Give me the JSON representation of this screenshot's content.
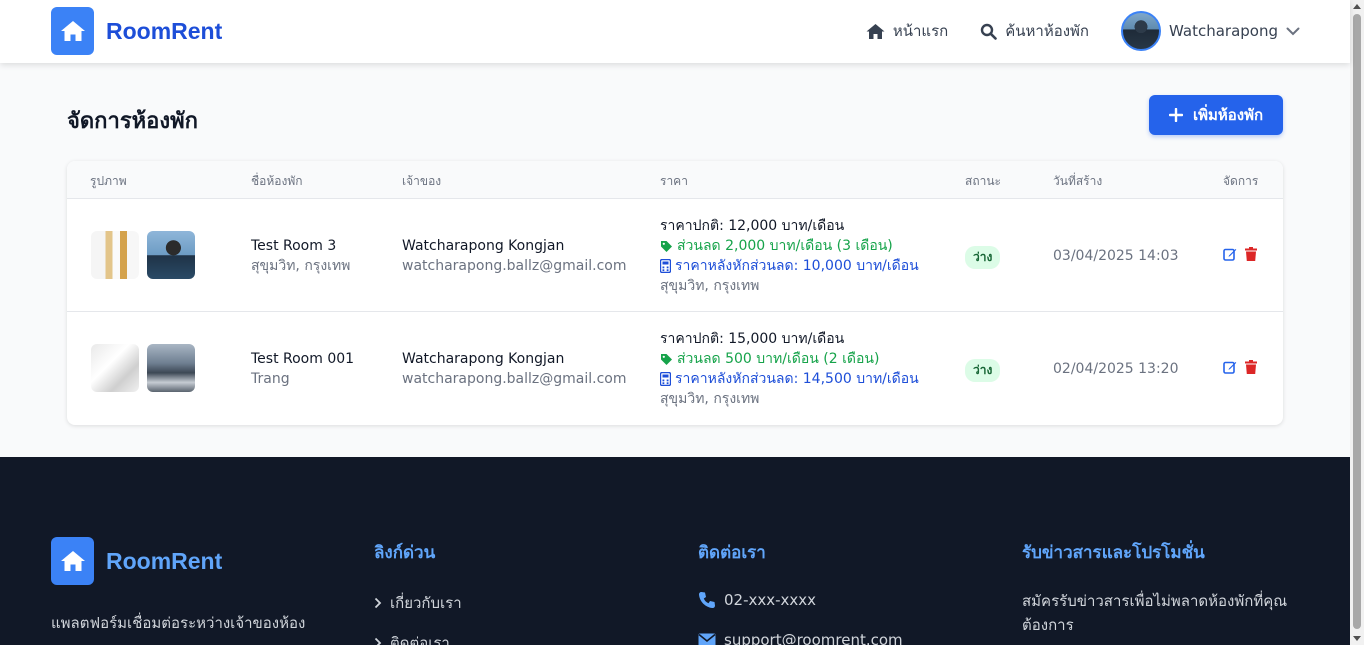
{
  "navbar": {
    "brand": "RoomRent",
    "links": [
      {
        "label": "หน้าแรก",
        "icon": "home-icon"
      },
      {
        "label": "ค้นหาห้องพัก",
        "icon": "search-icon"
      }
    ],
    "user": {
      "name": "Watcharapong"
    }
  },
  "page": {
    "title": "จัดการห้องพัก",
    "add_button": "เพิ่มห้องพัก"
  },
  "table": {
    "headers": [
      "รูปภาพ",
      "ชื่อห้องพัก",
      "เจ้าของ",
      "ราคา",
      "สถานะ",
      "วันที่สร้าง",
      "จัดการ"
    ],
    "rows": [
      {
        "name": "Test Room 3",
        "location": "สุขุมวิท, กรุงเทพ",
        "owner_name": "Watcharapong Kongjan",
        "owner_email": "watcharapong.ballz@gmail.com",
        "price_normal": "ราคาปกติ: 12,000 บาท/เดือน",
        "price_discount": "ส่วนลด 2,000 บาท/เดือน (3 เดือน)",
        "price_after": "ราคาหลังหักส่วนลด: 10,000 บาท/เดือน",
        "price_location": "สุขุมวิท, กรุงเทพ",
        "status": "ว่าง",
        "created": "03/04/2025 14:03"
      },
      {
        "name": "Test Room 001",
        "location": "Trang",
        "owner_name": "Watcharapong Kongjan",
        "owner_email": "watcharapong.ballz@gmail.com",
        "price_normal": "ราคาปกติ: 15,000 บาท/เดือน",
        "price_discount": "ส่วนลด 500 บาท/เดือน (2 เดือน)",
        "price_after": "ราคาหลังหักส่วนลด: 14,500 บาท/เดือน",
        "price_location": "สุขุมวิท, กรุงเทพ",
        "status": "ว่าง",
        "created": "02/04/2025 13:20"
      }
    ]
  },
  "footer": {
    "brand": "RoomRent",
    "description": "แพลตฟอร์มเชื่อมต่อระหว่างเจ้าของห้อง",
    "quick_links": {
      "title": "ลิงก์ด่วน",
      "items": [
        "เกี่ยวกับเรา",
        "ติดต่อเรา"
      ]
    },
    "contact": {
      "title": "ติดต่อเรา",
      "phone": "02-xxx-xxxx",
      "email": "support@roomrent.com"
    },
    "newsletter": {
      "title": "รับข่าวสารและโปรโมชั่น",
      "text": "สมัครรับข่าวสารเพื่อไม่พลาดห้องพักที่คุณต้องการ"
    }
  },
  "colors": {
    "primary": "#2563eb",
    "footer_bg": "#111827",
    "accent_text": "#60a5fa",
    "success": "#16a34a",
    "danger": "#dc2626"
  }
}
